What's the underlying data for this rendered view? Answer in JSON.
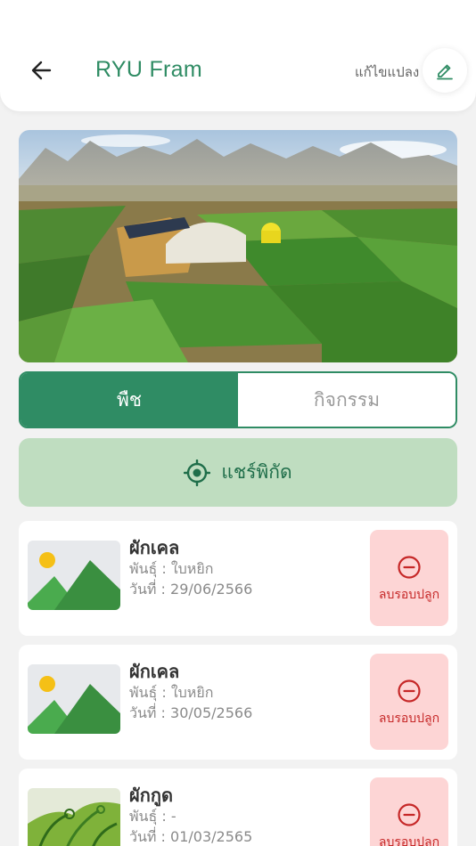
{
  "header": {
    "title": "RYU Fram",
    "edit_label": "แก้ไขแปลง"
  },
  "tabs": [
    {
      "label": "พืช",
      "active": true
    },
    {
      "label": "กิจกรรม",
      "active": false
    }
  ],
  "share": {
    "label": "แชร์พิกัด"
  },
  "plants": [
    {
      "name": "ผักเคล",
      "variety": "พันธุ์ : ใบหยิก",
      "date": "วันที่ : 29/06/2566",
      "delete_label": "ลบรอบปลูก",
      "image": "placeholder-image-icon"
    },
    {
      "name": "ผักเคล",
      "variety": "พันธุ์ : ใบหยิก",
      "date": "วันที่ : 30/05/2566",
      "delete_label": "ลบรอบปลูก",
      "image": "placeholder-image-icon"
    },
    {
      "name": "ผักกูด",
      "variety": "พันธุ์ : -",
      "date": "วันที่ : 01/03/2565",
      "delete_label": "ลบรอบปลูก",
      "image": "fern-photo"
    }
  ],
  "colors": {
    "primary": "#2f8c64",
    "share_bg": "#bfddc0",
    "delete_bg": "#fdd5d5",
    "delete_fg": "#c62828"
  }
}
